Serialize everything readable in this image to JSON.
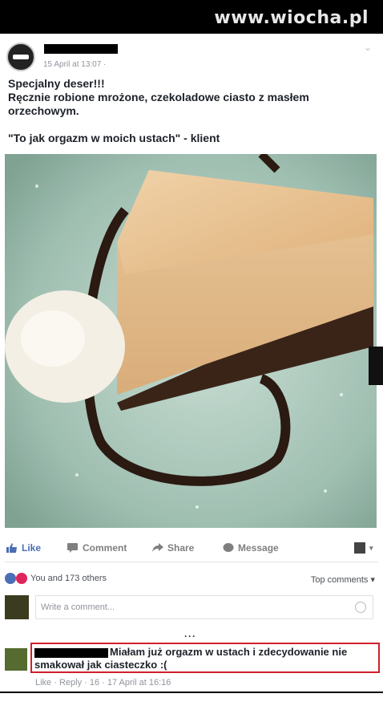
{
  "watermark": "www.wiocha.pl",
  "post": {
    "timestamp": "15 April at 13:07 ·",
    "lines": [
      "Specjalny deser!!!",
      "Ręcznie robione mrożone, czekoladowe ciasto z masłem orzechowym.",
      "",
      "\"To jak orgazm w moich ustach\" - klient"
    ]
  },
  "actions": {
    "like": "Like",
    "comment": "Comment",
    "share": "Share",
    "message": "Message"
  },
  "reactions": {
    "text": "You and 173 others",
    "top_comments": "Top comments ▾"
  },
  "write_comment": {
    "placeholder": "Write a comment..."
  },
  "more": "···",
  "comment": {
    "text": "Miałam już orgazm w ustach i zdecydowanie nie smakował jak ciasteczko :(",
    "meta": "Like · Reply · 16 · 17 April at 16:16"
  },
  "colors": {
    "accent": "#4b6eb4",
    "highlight": "#d0202a"
  }
}
